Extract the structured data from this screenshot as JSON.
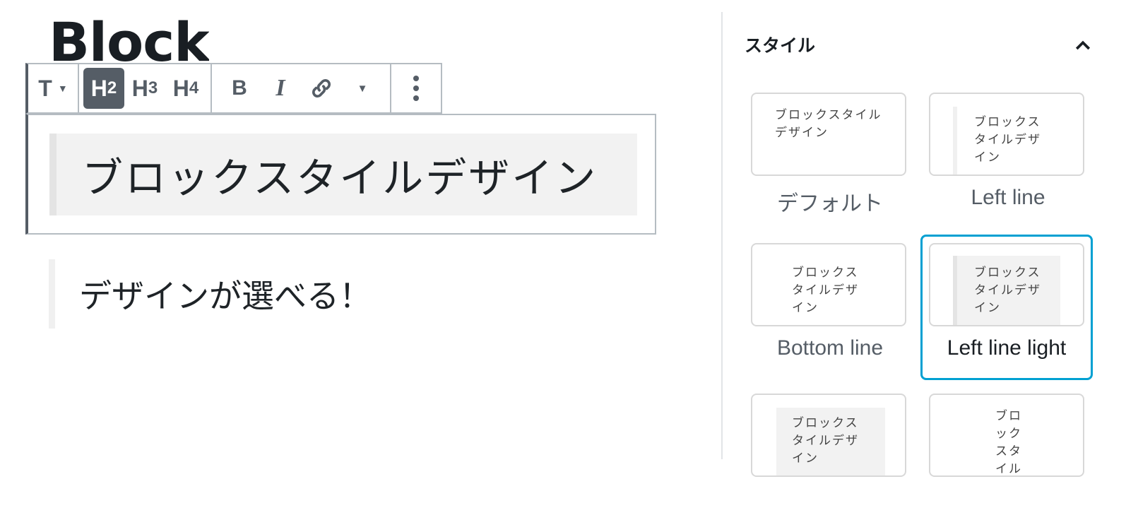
{
  "editor": {
    "post_title_partial": "Block",
    "heading_text": "ブロックスタイルデザイン",
    "paragraph_text": "デザインが選べる！"
  },
  "toolbar": {
    "block_type": "T",
    "heading_levels": [
      {
        "label": "H",
        "sub": "2",
        "active": true
      },
      {
        "label": "H",
        "sub": "3",
        "active": false
      },
      {
        "label": "H",
        "sub": "4",
        "active": false
      }
    ],
    "bold": "B",
    "italic": "I",
    "more_label": "⋮"
  },
  "sidebar": {
    "panel_title": "スタイル",
    "preview_text": "ブロックスタイルデザイン",
    "styles": [
      {
        "label": "デフォルト",
        "selected": false
      },
      {
        "label": "Left line",
        "selected": false
      },
      {
        "label": "Bottom line",
        "selected": false
      },
      {
        "label": "Left line light",
        "selected": true
      },
      {
        "label": "",
        "selected": false
      },
      {
        "label": "",
        "selected": false
      }
    ],
    "accent_color": "#00a0d2"
  }
}
